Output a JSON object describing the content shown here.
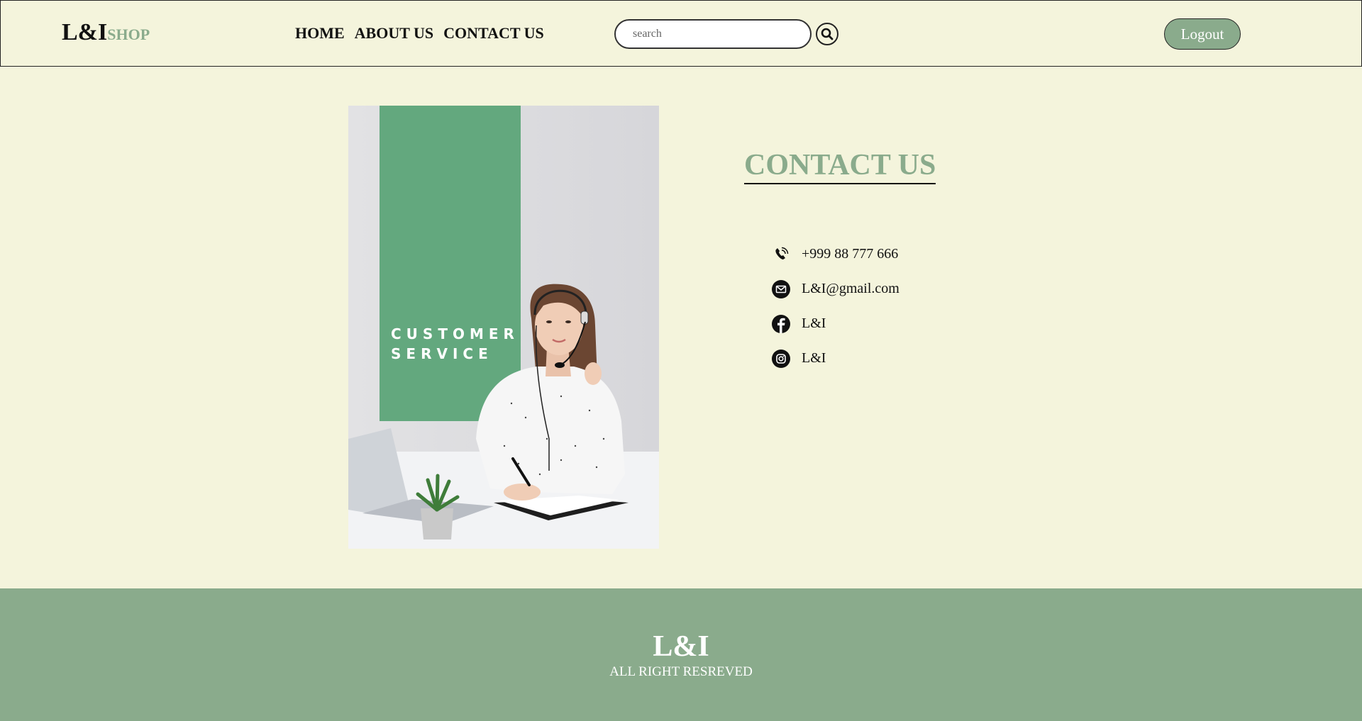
{
  "header": {
    "logo_main": "L&I",
    "logo_sub": "SHOP",
    "nav": [
      "HOME",
      "ABOUT US",
      "CONTACT US"
    ],
    "search_placeholder": "search",
    "logout_label": "Logout"
  },
  "promo": {
    "line1": "CUSTOMER",
    "line2": "SERVICE"
  },
  "contact": {
    "title": "CONTACT US",
    "items": [
      {
        "icon": "phone-icon",
        "text": "+999 88 777 666"
      },
      {
        "icon": "email-icon",
        "text": "L&I@gmail.com"
      },
      {
        "icon": "facebook-icon",
        "text": "L&I"
      },
      {
        "icon": "instagram-icon",
        "text": "L&I"
      }
    ]
  },
  "footer": {
    "brand": "L&I",
    "rights": "ALL RIGHT RESREVED"
  },
  "colors": {
    "background": "#f4f4dc",
    "accent": "#8aab8c",
    "promo_green": "#63a87e"
  }
}
